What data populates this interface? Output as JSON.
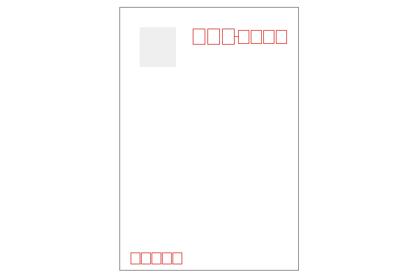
{
  "postcard": {
    "border_color": "#777777",
    "stamp_area_color": "#efefef",
    "postal_code_color": "#d93a3a",
    "recipient_postal_code": {
      "large_box_count": 3,
      "small_box_count": 4
    },
    "sender_postal_code": {
      "box_count": 5
    }
  }
}
